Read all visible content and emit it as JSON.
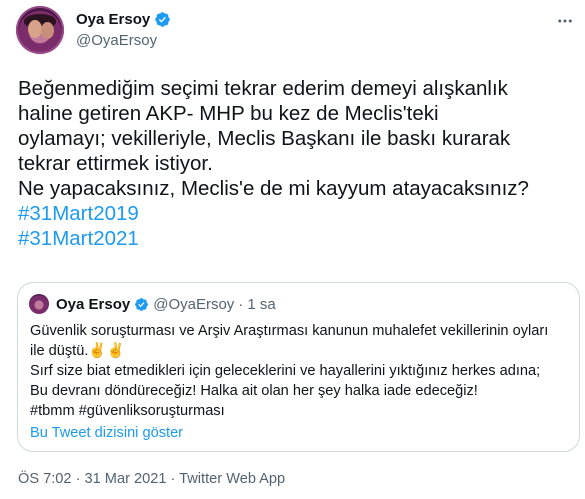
{
  "author": {
    "display_name": "Oya Ersoy",
    "handle": "@OyaErsoy",
    "verified": true,
    "avatar_icon": "avatar-photo"
  },
  "tweet": {
    "lines": [
      "Beğenmediğim seçimi tekrar ederim demeyi alışkanlık",
      "haline getiren AKP- MHP bu kez de Meclis'teki",
      "oylamayı; vekilleriyle, Meclis Başkanı ile baskı kurarak",
      "tekrar ettirmek istiyor.",
      "Ne yapacaksınız, Meclis'e de mi kayyum atayacaksınız?"
    ],
    "hashtags": [
      "#31Mart2019",
      "#31Mart2021"
    ]
  },
  "quoted": {
    "display_name": "Oya Ersoy",
    "handle": "@OyaErsoy",
    "separator": "·",
    "time": "1 sa",
    "lines": [
      "Güvenlik soruşturması ve Arşiv Araştırması kanunun muhalefet vekillerinin oyları",
      "ile düştü.✌️✌️",
      "Sırf  size biat etmedikleri için geleceklerini ve hayallerini yıktığınız herkes adına;",
      "Bu devranı döndüreceğiz! Halka ait olan her şey halka iade edeceğiz!",
      "#tbmm #güvenliksoruşturması"
    ],
    "show_thread": "Bu Tweet dizisini göster"
  },
  "meta": {
    "text": "ÖS 7:02 · 31 Mar 2021 · Twitter Web App"
  },
  "colors": {
    "accent": "#1d9bf0",
    "text": "#0f1419",
    "secondary": "#536471",
    "border": "#cfd9de"
  }
}
